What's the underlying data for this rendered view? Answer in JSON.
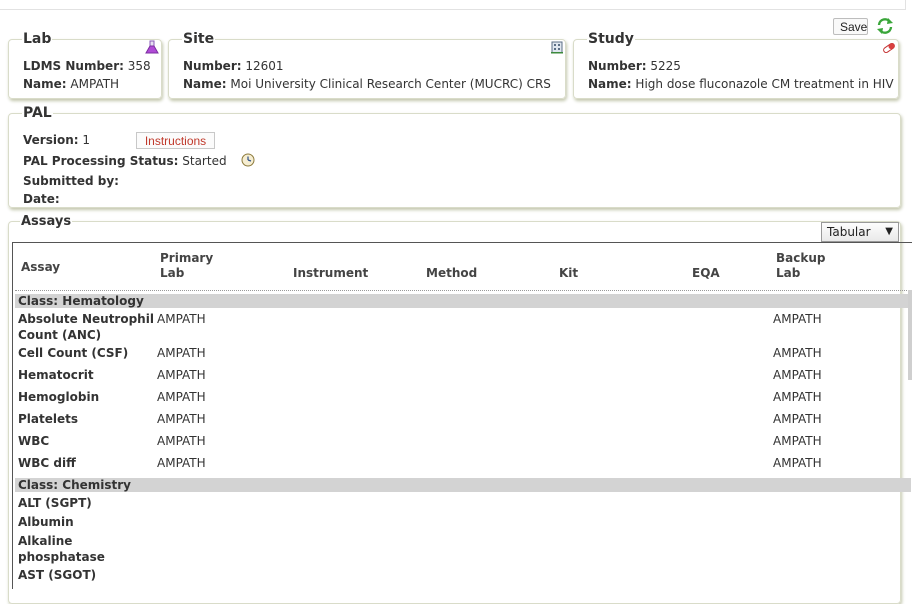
{
  "toolbar": {
    "save_label": "Save",
    "refresh_icon": "refresh-icon"
  },
  "lab": {
    "legend": "Lab",
    "ldms_label": "LDMS Number:",
    "ldms_value": "358",
    "name_label": "Name:",
    "name_value": "AMPATH",
    "icon": "flask-icon"
  },
  "site": {
    "legend": "Site",
    "number_label": "Number:",
    "number_value": "12601",
    "name_label": "Name:",
    "name_value": "Moi University Clinical Research Center (MUCRC) CRS",
    "icon": "building-icon"
  },
  "study": {
    "legend": "Study",
    "number_label": "Number:",
    "number_value": "5225",
    "name_label": "Name:",
    "name_value": "High dose fluconazole CM treatment in HIV",
    "icon": "pill-icon"
  },
  "pal": {
    "legend": "PAL",
    "version_label": "Version:",
    "version_value": "1",
    "instructions_label": "Instructions",
    "status_label": "PAL Processing Status:",
    "status_value": "Started",
    "submitted_label": "Submitted by:",
    "submitted_value": "",
    "date_label": "Date:",
    "date_value": "",
    "history_icon": "clock-icon"
  },
  "assays": {
    "legend": "Assays",
    "view_select": "Tabular",
    "headers": {
      "assay": "Assay",
      "primary_lab_1": "Primary",
      "primary_lab_2": "Lab",
      "instrument": "Instrument",
      "method": "Method",
      "kit": "Kit",
      "eqa": "EQA",
      "backup_lab_1": "Backup",
      "backup_lab_2": "Lab"
    },
    "classes": [
      {
        "label": "Class: Hematology"
      },
      {
        "label": "Class: Chemistry"
      }
    ],
    "rows": [
      {
        "assay_1": "Absolute Neutrophil",
        "assay_2": "Count (ANC)",
        "primary": "AMPATH",
        "backup": "AMPATH"
      },
      {
        "assay_1": "Cell Count (CSF)",
        "assay_2": "",
        "primary": "AMPATH",
        "backup": "AMPATH"
      },
      {
        "assay_1": "Hematocrit",
        "assay_2": "",
        "primary": "AMPATH",
        "backup": "AMPATH"
      },
      {
        "assay_1": "Hemoglobin",
        "assay_2": "",
        "primary": "AMPATH",
        "backup": "AMPATH"
      },
      {
        "assay_1": "Platelets",
        "assay_2": "",
        "primary": "AMPATH",
        "backup": "AMPATH"
      },
      {
        "assay_1": "WBC",
        "assay_2": "",
        "primary": "AMPATH",
        "backup": "AMPATH"
      },
      {
        "assay_1": "WBC diff",
        "assay_2": "",
        "primary": "AMPATH",
        "backup": "AMPATH"
      },
      {
        "assay_1": "ALT (SGPT)",
        "assay_2": "",
        "primary": "",
        "backup": ""
      },
      {
        "assay_1": "Albumin",
        "assay_2": "",
        "primary": "",
        "backup": ""
      },
      {
        "assay_1": "Alkaline",
        "assay_2": "phosphatase",
        "primary": "",
        "backup": ""
      },
      {
        "assay_1": "AST (SGOT)",
        "assay_2": "",
        "primary": "",
        "backup": ""
      }
    ]
  }
}
